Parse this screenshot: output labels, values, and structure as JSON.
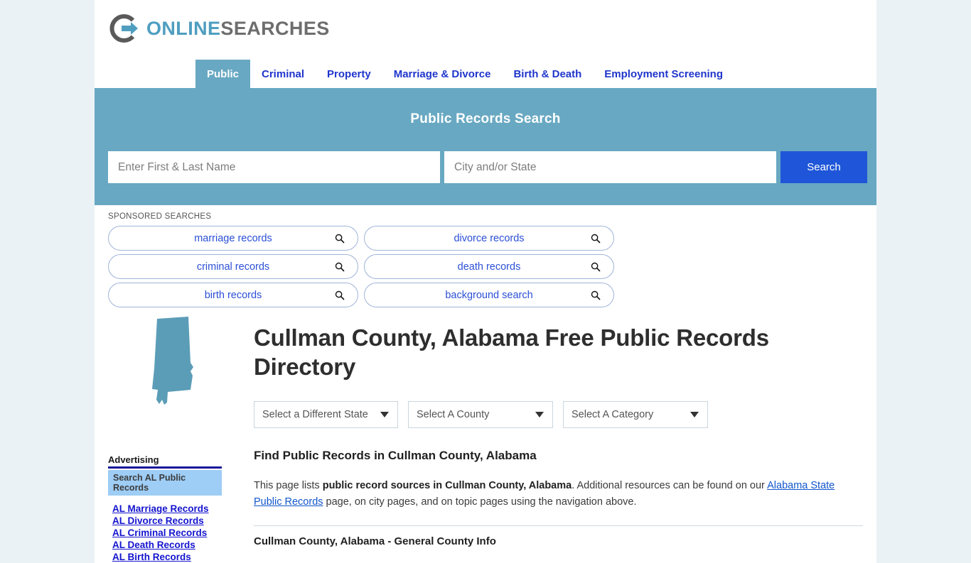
{
  "brand": {
    "logo_icon": "circle-arrow-logo-icon",
    "name_part1": "ONLINE",
    "name_part2": "SEARCHES",
    "accent_blue": "#4f9ec0",
    "accent_gray": "#6d6d6d"
  },
  "nav": {
    "items": [
      {
        "label": "Public",
        "active": true
      },
      {
        "label": "Criminal",
        "active": false
      },
      {
        "label": "Property",
        "active": false
      },
      {
        "label": "Marriage & Divorce",
        "active": false
      },
      {
        "label": "Birth & Death",
        "active": false
      },
      {
        "label": "Employment Screening",
        "active": false
      }
    ]
  },
  "banner": {
    "title": "Public Records Search",
    "background": "#68a8c2",
    "name_input": {
      "value": "",
      "placeholder": "Enter First & Last Name"
    },
    "city_input": {
      "value": "",
      "placeholder": "City and/or State"
    },
    "search_button": "Search",
    "search_button_color": "#1f56d9"
  },
  "sponsored": {
    "label": "SPONSORED SEARCHES",
    "pills": [
      {
        "label": "marriage records",
        "icon": "search-icon"
      },
      {
        "label": "divorce records",
        "icon": "search-icon"
      },
      {
        "label": "criminal records",
        "icon": "search-icon"
      },
      {
        "label": "death records",
        "icon": "search-icon"
      },
      {
        "label": "birth records",
        "icon": "search-icon"
      },
      {
        "label": "background search",
        "icon": "search-icon"
      }
    ]
  },
  "sidebar": {
    "state_map_icon": "alabama-state-map-icon",
    "state_map_color": "#5b9db7",
    "ad_heading": "Advertising",
    "ad_search_box": "Search AL Public Records",
    "links": [
      "AL Marriage Records",
      "AL Divorce Records",
      "AL Criminal Records",
      "AL Death Records",
      "AL Birth Records"
    ]
  },
  "main": {
    "title": "Cullman County, Alabama Free Public Records Directory",
    "selects": [
      {
        "label": "Select a Different State",
        "icon": "chevron-down-icon"
      },
      {
        "label": "Select A County",
        "icon": "chevron-down-icon"
      },
      {
        "label": "Select A Category",
        "icon": "chevron-down-icon"
      }
    ],
    "section_title": "Find Public Records in Cullman County, Alabama",
    "intro": {
      "part1": "This page lists ",
      "bold1": "public record sources in Cullman County, Alabama",
      "part2": ". Additional resources can be found on our ",
      "link": "Alabama State Public Records",
      "part3": " page, on city pages, and on topic pages using the navigation above."
    },
    "subsection_title": "Cullman County, Alabama - General County Info"
  }
}
